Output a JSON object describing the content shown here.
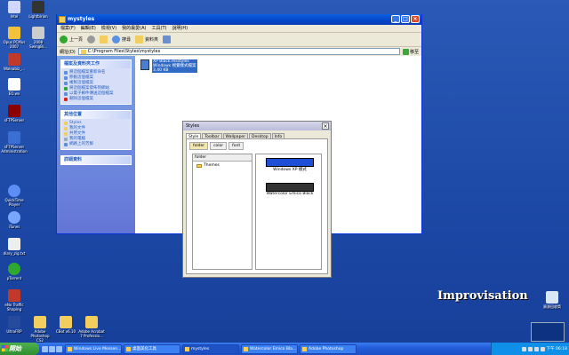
{
  "desktop_icons": [
    {
      "label": "Intel",
      "color": "#d0d8ff"
    },
    {
      "label": "Lightbirion",
      "color": "#333"
    },
    {
      "label": "Opus PCMus 2007",
      "color": "#f3c23a"
    },
    {
      "label": "2008 SwingBi...",
      "color": "#cccccc"
    },
    {
      "label": "Walnabiz_...",
      "color": "#c0392b"
    },
    {
      "label": "EO.wx",
      "color": "#ffffff"
    },
    {
      "label": "sFTPServer",
      "color": "#8b0000"
    },
    {
      "label": "sFTPServer Administration",
      "color": "#3b6fd3"
    },
    {
      "label": "QuickTime Player",
      "color": "#5c8ef5"
    },
    {
      "label": "iTunes",
      "color": "#7aa6ff"
    },
    {
      "label": "diary_zig.txt",
      "color": "#eeeeee"
    },
    {
      "label": "pTorrent",
      "color": "#2ea82e"
    },
    {
      "label": "eNo Traffic Shaping",
      "color": "#c0392b"
    },
    {
      "label": "UltraFRP",
      "color": "#264a9c"
    },
    {
      "label": "Adobe Photoshop CS2",
      "color": "#f3cd5d"
    },
    {
      "label": "CBot v6.10",
      "color": "#f3cd5d"
    },
    {
      "label": "Adobe Acrobat 7 Professio...",
      "color": "#f3cd5d"
    },
    {
      "label": "資源回收筒",
      "color": "#d9e6f5"
    }
  ],
  "explorer": {
    "title": "mystyles",
    "menu": [
      "檔案(F)",
      "編輯(E)",
      "檢視(V)",
      "我的最愛(A)",
      "工具(T)",
      "說明(H)"
    ],
    "toolbar": {
      "back": "上一頁",
      "search": "搜尋",
      "folders": "資料夾"
    },
    "address_label": "網址(D)",
    "address": "C:\\Program Files\\Styles\\mystyles",
    "go": "移至",
    "task_panel": {
      "title": "檔案及資料夾工作",
      "items": [
        "將這個檔案重新命名",
        "移動這個檔案",
        "複製這個檔案",
        "將這個檔案發佈到網站",
        "以電子郵件傳送這個檔案",
        "刪除這個檔案"
      ]
    },
    "places_panel": {
      "title": "其他位置",
      "items": [
        "Styles",
        "我的文件",
        "共用文件",
        "我的電腦",
        "網路上的芳鄰"
      ]
    },
    "details_panel": {
      "title": "詳細資料"
    },
    "file": {
      "line1": "XP Black.msstyles",
      "line2": "Windows 視覺樣式檔案",
      "line3": "3.40 KB"
    }
  },
  "styles_dialog": {
    "title": "Styles",
    "close": "×",
    "tabs": [
      "Style",
      "Toolbar",
      "Wallpaper",
      "Desktop",
      "Info"
    ],
    "subtabs": [
      "folder",
      "color",
      "font"
    ],
    "tree_header": "folder",
    "tree_items": [
      "Themes"
    ],
    "previews": [
      {
        "label": "Windows XP 樣式",
        "color": "#1f4fd6"
      },
      {
        "label": "Watercolor Emico Black",
        "color": "#333333"
      }
    ]
  },
  "logo_text": "Improvisation",
  "taskbar": {
    "start": "開始",
    "tasks": [
      "Windows Live Messen...",
      "桌面美化工具",
      "mystyles",
      "Watercolor Emico Bla...",
      "Adobe Photoshop"
    ],
    "active_index": 2,
    "clock": "下午 06:18"
  }
}
